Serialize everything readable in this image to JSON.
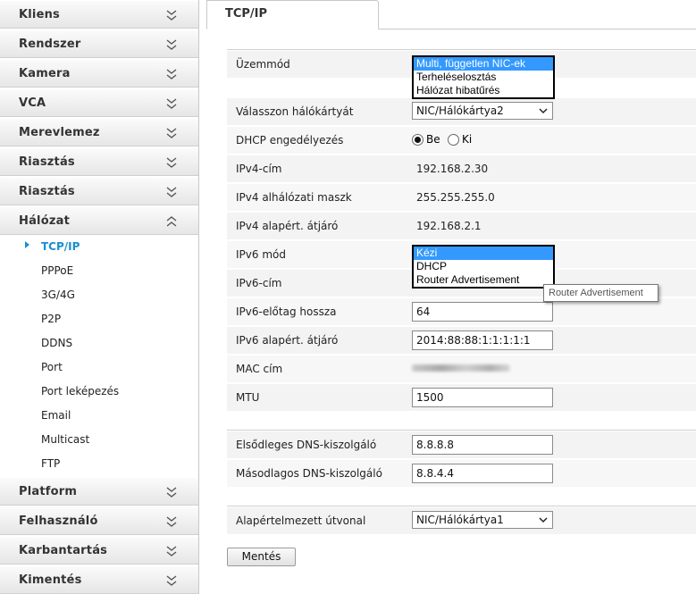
{
  "sidebar": {
    "categories_top": [
      {
        "label": "Kliens"
      },
      {
        "label": "Rendszer"
      },
      {
        "label": "Kamera"
      },
      {
        "label": "VCA"
      },
      {
        "label": "Merevlemez"
      },
      {
        "label": "Riasztás"
      },
      {
        "label": "Riasztás"
      },
      {
        "label": "Hálózat"
      }
    ],
    "network_items": [
      {
        "label": "TCP/IP"
      },
      {
        "label": "PPPoE"
      },
      {
        "label": "3G/4G"
      },
      {
        "label": "P2P"
      },
      {
        "label": "DDNS"
      },
      {
        "label": "Port"
      },
      {
        "label": "Port leképezés"
      },
      {
        "label": "Email"
      },
      {
        "label": "Multicast"
      },
      {
        "label": "FTP"
      }
    ],
    "categories_bottom": [
      {
        "label": "Platform"
      },
      {
        "label": "Felhasználó"
      },
      {
        "label": "Karbantartás"
      },
      {
        "label": "Kimentés"
      }
    ]
  },
  "tab": {
    "label": "TCP/IP"
  },
  "form": {
    "mode": {
      "label": "Üzemmód",
      "options": [
        "Multi, független NIC-ek",
        "Terheléselosztás",
        "Hálózat hibatűrés"
      ]
    },
    "nic": {
      "label": "Válasszon hálókártyát",
      "value": "NIC/Hálókártya2"
    },
    "dhcp": {
      "label": "DHCP engedélyezés",
      "on_label": "Be",
      "off_label": "Ki"
    },
    "ipv4_addr": {
      "label": "IPv4-cím",
      "value": "192.168.2.30"
    },
    "ipv4_mask": {
      "label": "IPv4 alhálózati maszk",
      "value": "255.255.255.0"
    },
    "ipv4_gw": {
      "label": "IPv4 alapért. átjáró",
      "value": "192.168.2.1"
    },
    "ipv6_mode": {
      "label": "IPv6 mód",
      "options": [
        "Kézi",
        "DHCP",
        "Router Advertisement"
      ]
    },
    "ipv6_addr": {
      "label": "IPv6-cím"
    },
    "ipv6_prefix": {
      "label": "IPv6-előtag hossza",
      "value": "64"
    },
    "ipv6_gw": {
      "label": "IPv6 alapért. átjáró",
      "value": "2014:88:88:1:1:1:1:1"
    },
    "mac": {
      "label": "MAC cím"
    },
    "mtu": {
      "label": "MTU",
      "value": "1500"
    },
    "dns1": {
      "label": "Elsődleges DNS-kiszolgáló",
      "value": "8.8.8.8"
    },
    "dns2": {
      "label": "Másodlagos DNS-kiszolgáló",
      "value": "8.8.4.4"
    },
    "route": {
      "label": "Alapértelmezett útvonal",
      "value": "NIC/Hálókártya1"
    },
    "save_label": "Mentés"
  },
  "tooltip": {
    "text": "Router Advertisement"
  },
  "colors": {
    "accent": "#1a8fd0",
    "selection": "#3399ff"
  }
}
